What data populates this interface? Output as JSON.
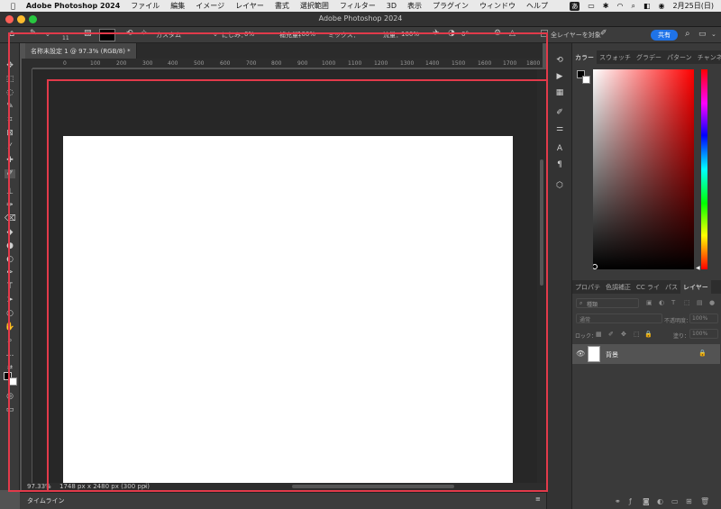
{
  "menubar": {
    "app_name": "Adobe Photoshop 2024",
    "menus": [
      "ファイル",
      "編集",
      "イメージ",
      "レイヤー",
      "書式",
      "選択範囲",
      "フィルター",
      "3D",
      "表示",
      "プラグイン",
      "ウィンドウ",
      "ヘルプ"
    ],
    "input_method": "あ",
    "date": "2月25日(日)"
  },
  "window": {
    "title": "Adobe Photoshop 2024"
  },
  "options": {
    "brush_size": "11",
    "custom_label": "カスタム",
    "smudge_label": "にじみ：",
    "smudge_value": "0%",
    "moisture_label": "補充量：",
    "moisture_value": "100%",
    "mix_label": "ミックス：",
    "flow_label": "流量：",
    "flow_value": "100%",
    "angle_value": "0°",
    "all_layers": "全レイヤーを対象",
    "share": "共有"
  },
  "document": {
    "tab_title": "名称未設定 1 @ 97.3% (RGB/8) *",
    "zoom": "97.33%",
    "info": "1748 px x 2480 px (300 ppi)"
  },
  "ruler_ticks": [
    "0",
    "100",
    "200",
    "300",
    "400",
    "500",
    "600",
    "700",
    "800",
    "900",
    "1000",
    "1100",
    "1200",
    "1300",
    "1400",
    "1500",
    "1600",
    "1700",
    "1800"
  ],
  "timeline": {
    "label": "タイムライン"
  },
  "color_panel": {
    "tabs": [
      "カラー",
      "スウォッチ",
      "グラデー",
      "パターン",
      "チャンネ"
    ],
    "hue_top": "#ff0000"
  },
  "layers_panel": {
    "tabs": [
      "プロパテ",
      "色調補正",
      "CC ライ",
      "パス",
      "レイヤー"
    ],
    "filter_label": "種類",
    "blend_mode": "通常",
    "opacity_label": "不透明度：",
    "opacity_value": "100%",
    "lock_label": "ロック：",
    "fill_label": "塗り：",
    "fill_value": "100%",
    "layer_name": "背景"
  },
  "colors": {
    "highlight": "#e23a4a",
    "accent": "#1f73e8"
  }
}
